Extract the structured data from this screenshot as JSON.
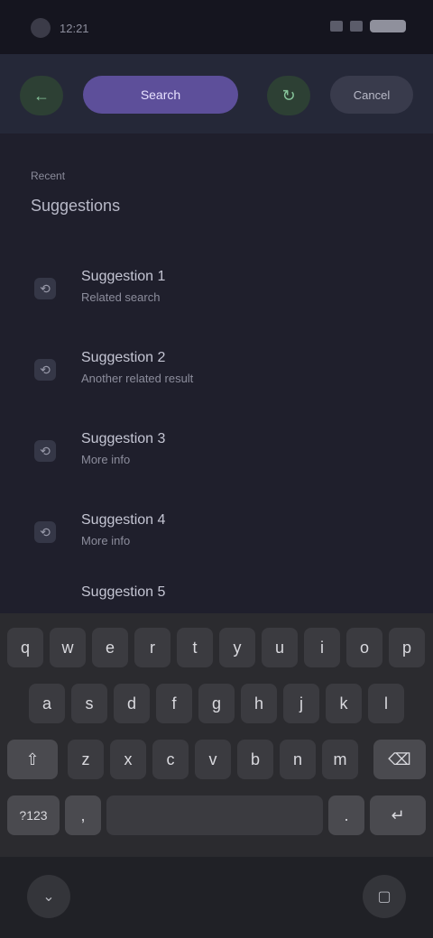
{
  "status_bar": {
    "time": "12:21",
    "battery": "battery",
    "signal": "signal"
  },
  "toolbar": {
    "left_icon": "back-icon",
    "pill_label": "Search",
    "mid_icon": "refresh-icon",
    "right_pill_label": "Cancel"
  },
  "section": {
    "overline": "Recent",
    "title": "Suggestions"
  },
  "list": {
    "items": [
      {
        "title": "Suggestion 1",
        "subtitle": "Related search"
      },
      {
        "title": "Suggestion 2",
        "subtitle": "Another related result"
      },
      {
        "title": "Suggestion 3",
        "subtitle": "More info"
      },
      {
        "title": "Suggestion 4",
        "subtitle": "More info"
      },
      {
        "title": "Suggestion 5",
        "subtitle": ""
      }
    ]
  },
  "keyboard": {
    "row1": [
      "q",
      "w",
      "e",
      "r",
      "t",
      "y",
      "u",
      "i",
      "o",
      "p"
    ],
    "row2": [
      "a",
      "s",
      "d",
      "f",
      "g",
      "h",
      "j",
      "k",
      "l"
    ],
    "row3": [
      "z",
      "x",
      "c",
      "v",
      "b",
      "n",
      "m"
    ],
    "shift": "⇧",
    "backspace": "⌫",
    "numbers": "?123",
    "comma": ",",
    "space": "",
    "period": ".",
    "enter": "↵"
  },
  "navbar": {
    "left_icon": "keyboard-hide-icon",
    "right_icon": "recents-icon"
  }
}
